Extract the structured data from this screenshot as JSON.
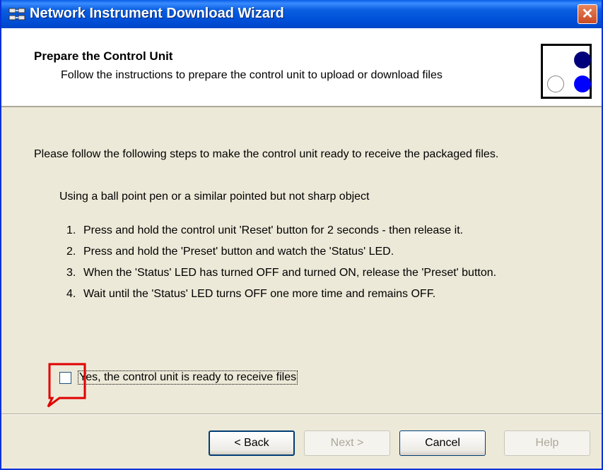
{
  "window": {
    "title": "Network Instrument Download Wizard",
    "close_glyph": "✕"
  },
  "header": {
    "title": "Prepare the Control Unit",
    "subtitle": "Follow the instructions to prepare the control unit to upload or download files"
  },
  "body": {
    "intro": "Please follow the following steps to make the control unit ready to receive the packaged files.",
    "sub_intro": "Using a ball point pen or a similar pointed but not sharp object",
    "steps": [
      {
        "num": "1.",
        "text": "Press and hold the control unit 'Reset' button for 2 seconds - then release it."
      },
      {
        "num": "2.",
        "text": "Press and hold the 'Preset' button and watch the 'Status' LED."
      },
      {
        "num": "3.",
        "text": "When the 'Status' LED has turned OFF and turned ON, release the 'Preset' button."
      },
      {
        "num": "4.",
        "text": "Wait until the 'Status' LED turns OFF one more time and remains OFF."
      }
    ],
    "checkbox": {
      "label": "Yes, the control unit is ready to receive files",
      "checked": false
    }
  },
  "buttons": {
    "back": "< Back",
    "next": "Next >",
    "cancel": "Cancel",
    "help": "Help"
  },
  "colors": {
    "titlebar": "#0050d8",
    "dialog_bg": "#ece9d8",
    "highlight_callout": "#e00000",
    "logo_dot_dark": "#00007a",
    "logo_dot_blue": "#0000ff"
  },
  "icons": {
    "app": "network-computers-icon",
    "logo": "wizard-dots-logo"
  }
}
